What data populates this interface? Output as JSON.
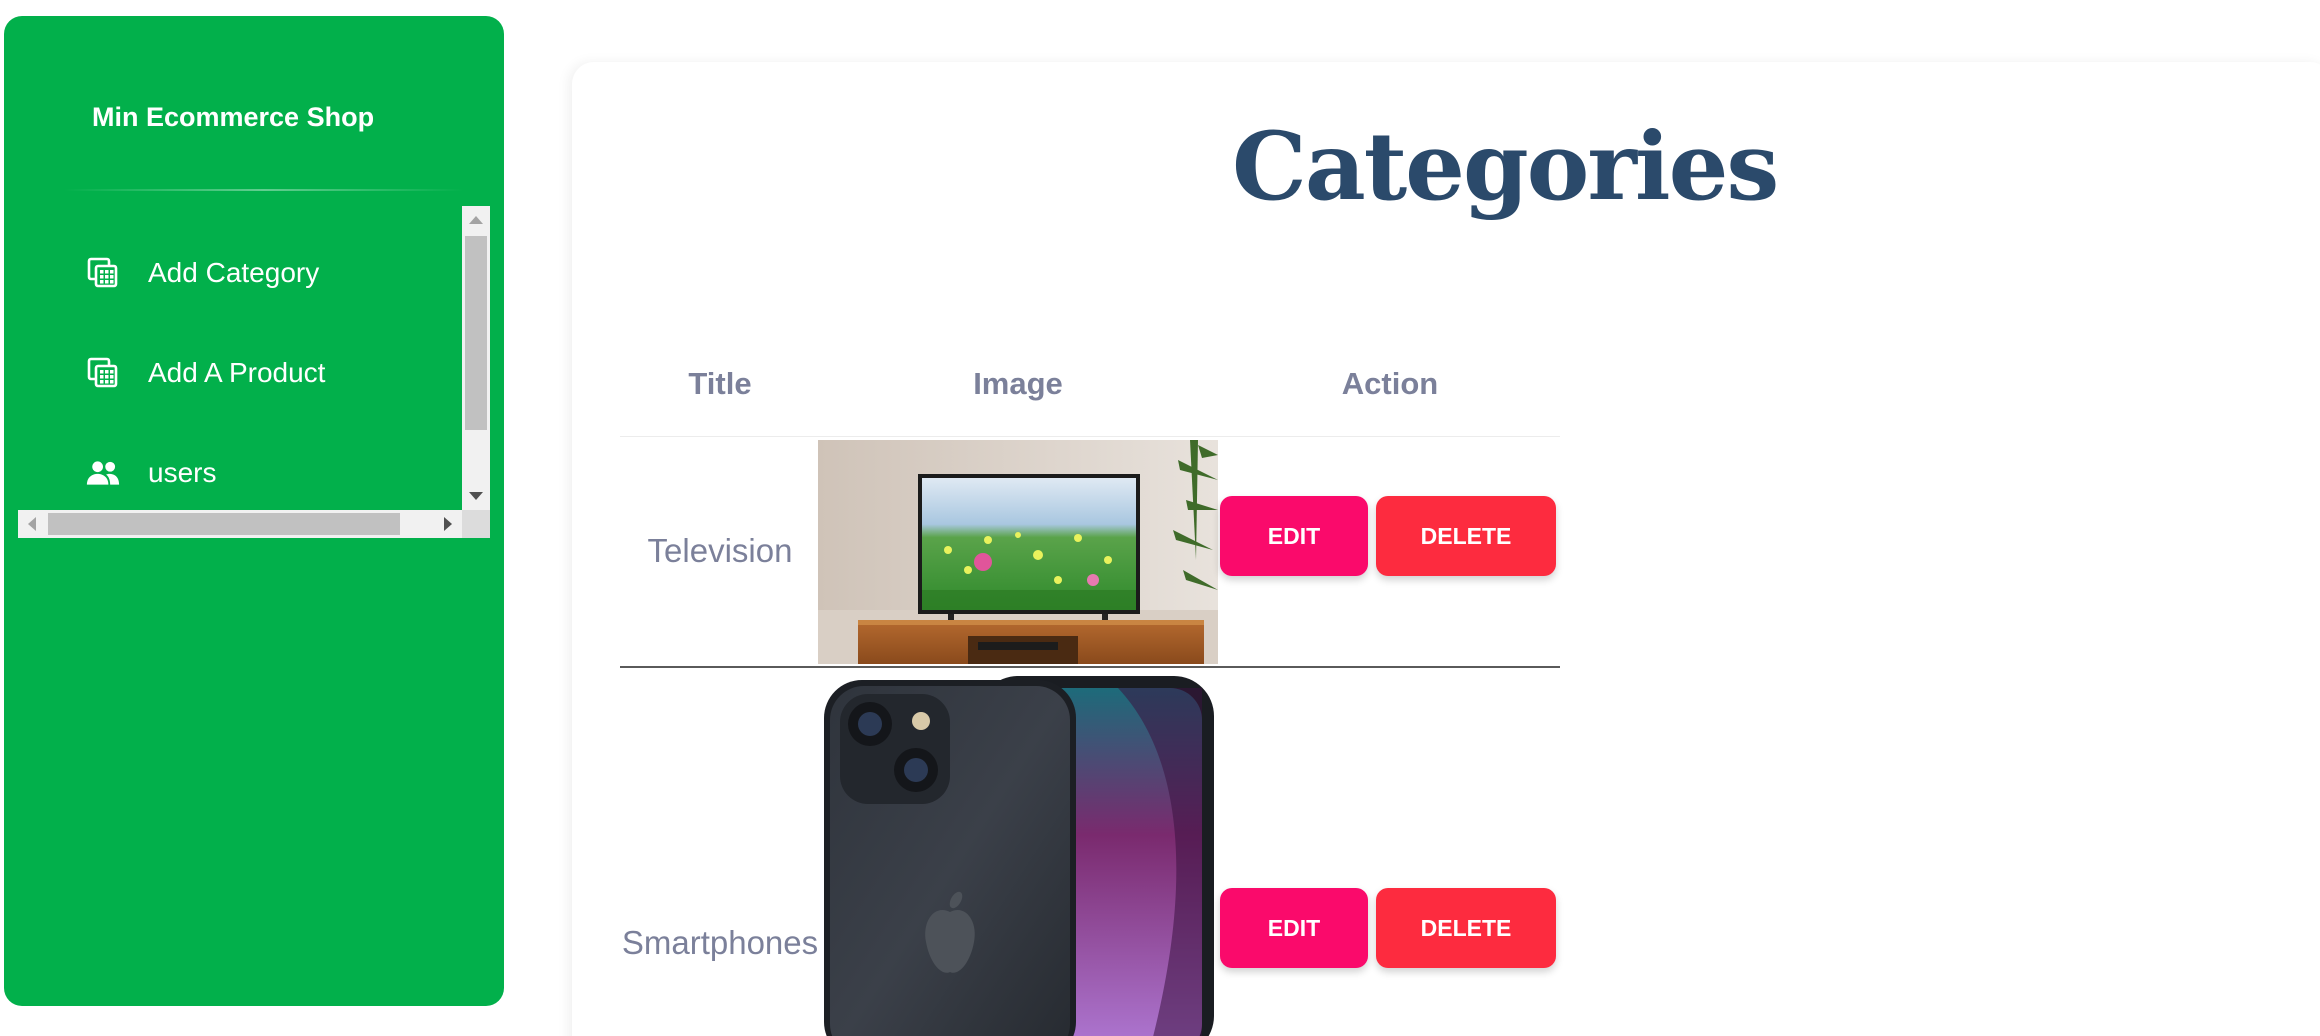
{
  "sidebar": {
    "brand": "Min Ecommerce Shop",
    "items": [
      {
        "label": "Add Category",
        "icon": "category-grid-icon"
      },
      {
        "label": "Add A Product",
        "icon": "product-grid-icon"
      },
      {
        "label": "users",
        "icon": "people-icon"
      }
    ],
    "color": "#02b04b"
  },
  "main": {
    "title": "Categories",
    "table": {
      "headers": [
        "Title",
        "Image",
        "Action"
      ],
      "rows": [
        {
          "title": "Television",
          "image": "television-photo",
          "edit_label": "EDIT",
          "delete_label": "DELETE"
        },
        {
          "title": "Smartphones",
          "image": "smartphone-photo",
          "edit_label": "EDIT",
          "delete_label": "DELETE"
        }
      ]
    },
    "colors": {
      "title": "#2b4a6b",
      "edit": "#fa0a6b",
      "delete": "#fd2b3f"
    }
  }
}
